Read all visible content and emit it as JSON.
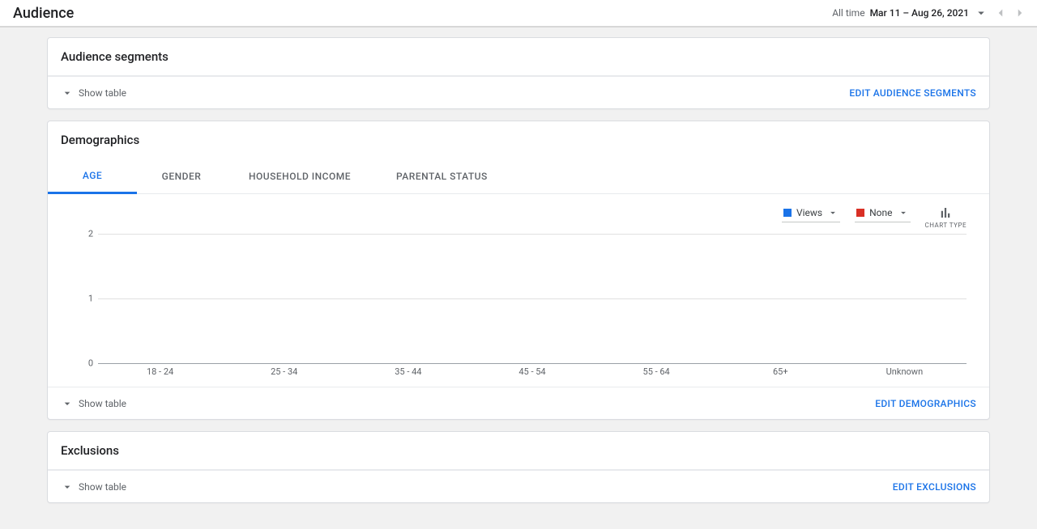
{
  "header": {
    "title": "Audience",
    "date_range_label": "All time",
    "date_range_value": "Mar 11 – Aug 26, 2021"
  },
  "cards": {
    "segments": {
      "title": "Audience segments",
      "show_table": "Show table",
      "edit": "EDIT AUDIENCE SEGMENTS"
    },
    "demographics": {
      "title": "Demographics",
      "tabs": [
        "AGE",
        "GENDER",
        "HOUSEHOLD INCOME",
        "PARENTAL STATUS"
      ],
      "active_tab_index": 0,
      "metric1": "Views",
      "metric2": "None",
      "chart_type_label": "CHART TYPE",
      "show_table": "Show table",
      "edit": "EDIT DEMOGRAPHICS"
    },
    "exclusions": {
      "title": "Exclusions",
      "show_table": "Show table",
      "edit": "EDIT EXCLUSIONS"
    }
  },
  "chart_data": {
    "type": "bar",
    "categories": [
      "18 - 24",
      "25 - 34",
      "35 - 44",
      "45 - 54",
      "55 - 64",
      "65+",
      "Unknown"
    ],
    "series": [
      {
        "name": "Views",
        "color": "#1a73e8",
        "values": [
          0,
          0,
          0,
          0,
          0,
          0,
          0
        ]
      }
    ],
    "yticks": [
      0,
      1,
      2
    ],
    "ylim": [
      0,
      2
    ],
    "title": "",
    "xlabel": "",
    "ylabel": ""
  }
}
